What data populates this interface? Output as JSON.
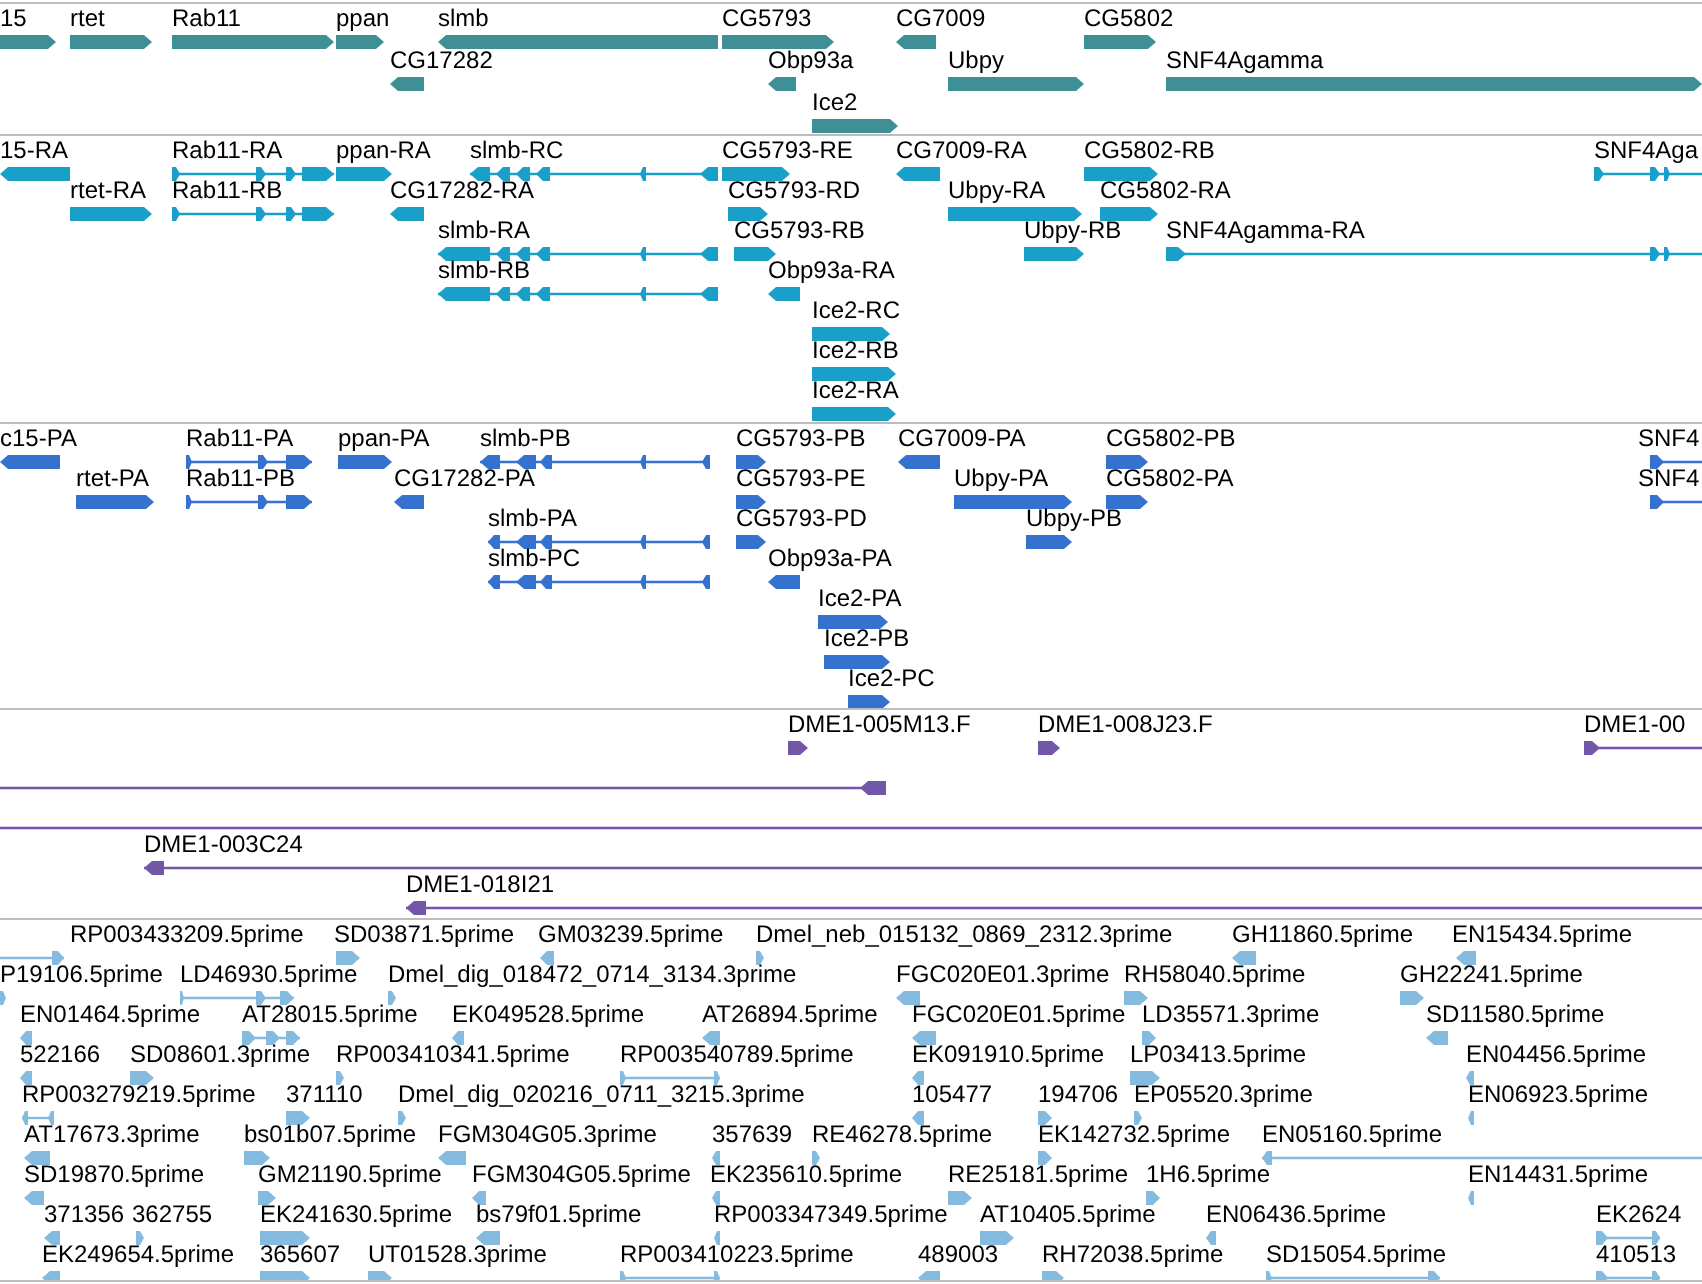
{
  "tracks": [
    {
      "kind": "gene",
      "color": "#3f8f96",
      "features": [
        {
          "label": "15",
          "reverse": false
        },
        {
          "label": "rtet",
          "reverse": false
        },
        {
          "label": "Rab11",
          "reverse": false
        },
        {
          "label": "ppan",
          "reverse": false
        },
        {
          "label": "slmb",
          "reverse": true
        },
        {
          "label": "CG5793",
          "reverse": false
        },
        {
          "label": "CG7009",
          "reverse": true
        },
        {
          "label": "CG5802",
          "reverse": false
        },
        {
          "label": "CG17282",
          "reverse": true
        },
        {
          "label": "Obp93a",
          "reverse": true
        },
        {
          "label": "Ubpy",
          "reverse": false
        },
        {
          "label": "SNF4Agamma",
          "reverse": false
        },
        {
          "label": "Ice2",
          "reverse": false
        }
      ]
    },
    {
      "kind": "transcript",
      "color": "#1aa0c8",
      "features": [
        {
          "label": "15-RA",
          "reverse": true
        },
        {
          "label": "Rab11-RA",
          "reverse": false
        },
        {
          "label": "ppan-RA",
          "reverse": false
        },
        {
          "label": "slmb-RC",
          "reverse": true
        },
        {
          "label": "CG5793-RE",
          "reverse": false
        },
        {
          "label": "CG7009-RA",
          "reverse": true
        },
        {
          "label": "CG5802-RB",
          "reverse": false
        },
        {
          "label": "SNF4Aga",
          "reverse": false
        },
        {
          "label": "rtet-RA",
          "reverse": false
        },
        {
          "label": "Rab11-RB",
          "reverse": false
        },
        {
          "label": "CG17282-RA",
          "reverse": true
        },
        {
          "label": "CG5793-RD",
          "reverse": false
        },
        {
          "label": "Ubpy-RA",
          "reverse": false
        },
        {
          "label": "CG5802-RA",
          "reverse": false
        },
        {
          "label": "slmb-RA",
          "reverse": true
        },
        {
          "label": "CG5793-RB",
          "reverse": false
        },
        {
          "label": "Ubpy-RB",
          "reverse": false
        },
        {
          "label": "SNF4Agamma-RA",
          "reverse": false
        },
        {
          "label": "slmb-RB",
          "reverse": true
        },
        {
          "label": "Obp93a-RA",
          "reverse": true
        },
        {
          "label": "Ice2-RC",
          "reverse": false
        },
        {
          "label": "Ice2-RB",
          "reverse": false
        },
        {
          "label": "Ice2-RA",
          "reverse": false
        }
      ]
    },
    {
      "kind": "protein",
      "color": "#3572d0",
      "features": [
        {
          "label": "c15-PA",
          "reverse": true
        },
        {
          "label": "Rab11-PA",
          "reverse": false
        },
        {
          "label": "ppan-PA",
          "reverse": false
        },
        {
          "label": "slmb-PB",
          "reverse": true
        },
        {
          "label": "CG5793-PB",
          "reverse": false
        },
        {
          "label": "CG7009-PA",
          "reverse": true
        },
        {
          "label": "CG5802-PB",
          "reverse": false
        },
        {
          "label": "SNF4",
          "reverse": false
        },
        {
          "label": "rtet-PA",
          "reverse": false
        },
        {
          "label": "Rab11-PB",
          "reverse": false
        },
        {
          "label": "CG17282-PA",
          "reverse": true
        },
        {
          "label": "CG5793-PE",
          "reverse": false
        },
        {
          "label": "Ubpy-PA",
          "reverse": false
        },
        {
          "label": "CG5802-PA",
          "reverse": false
        },
        {
          "label": "SNF4",
          "reverse": false
        },
        {
          "label": "slmb-PA",
          "reverse": true
        },
        {
          "label": "CG5793-PD",
          "reverse": false
        },
        {
          "label": "Ubpy-PB",
          "reverse": false
        },
        {
          "label": "slmb-PC",
          "reverse": true
        },
        {
          "label": "Obp93a-PA",
          "reverse": true
        },
        {
          "label": "Ice2-PA",
          "reverse": false
        },
        {
          "label": "Ice2-PB",
          "reverse": false
        },
        {
          "label": "Ice2-PC",
          "reverse": false
        }
      ]
    },
    {
      "kind": "clone",
      "color": "#7256a8",
      "features": [
        {
          "kind": "end",
          "label": "DME1-005M13.F",
          "reverse": false
        },
        {
          "kind": "end",
          "label": "DME1-008J23.F",
          "reverse": false
        },
        {
          "kind": "end",
          "label": "DME1-00",
          "reverse": false
        },
        {
          "kind": "end",
          "reverse": true
        },
        {
          "kind": "span"
        },
        {
          "kind": "end",
          "label": "DME1-003C24",
          "reverse": true
        },
        {
          "kind": "end",
          "label": "DME1-018I21",
          "reverse": true
        }
      ]
    },
    {
      "kind": "est",
      "color": "#86bbe0",
      "features": [
        {
          "label": "RP003433209.5prime",
          "reverse": false
        },
        {
          "label": "SD03871.5prime",
          "reverse": false
        },
        {
          "label": "GM03239.5prime",
          "reverse": true
        },
        {
          "label": "Dmel_neb_015132_0869_2312.3prime",
          "reverse": false
        },
        {
          "label": "GH11860.5prime",
          "reverse": true
        },
        {
          "label": "EN15434.5prime",
          "reverse": true
        },
        {
          "label": "P19106.5prime",
          "reverse": false
        },
        {
          "label": "LD46930.5prime",
          "reverse": false
        },
        {
          "label": "Dmel_dig_018472_0714_3134.3prime",
          "reverse": false
        },
        {
          "label": "FGC020E01.3prime",
          "reverse": true
        },
        {
          "label": "RH58040.5prime",
          "reverse": false
        },
        {
          "label": "GH22241.5prime",
          "reverse": false
        },
        {
          "label": "EN01464.5prime",
          "reverse": true
        },
        {
          "label": "AT28015.5prime",
          "reverse": false
        },
        {
          "label": "EK049528.5prime",
          "reverse": true
        },
        {
          "label": "AT26894.5prime",
          "reverse": true
        },
        {
          "label": "FGC020E01.5prime",
          "reverse": true
        },
        {
          "label": "LD35571.3prime",
          "reverse": false
        },
        {
          "label": "SD11580.5prime",
          "reverse": true
        },
        {
          "label": "522166",
          "reverse": true
        },
        {
          "label": "SD08601.3prime",
          "reverse": false
        },
        {
          "label": "RP003410341.5prime",
          "reverse": false
        },
        {
          "label": "RP003540789.5prime",
          "reverse": false
        },
        {
          "label": "EK091910.5prime",
          "reverse": true
        },
        {
          "label": "LP03413.5prime",
          "reverse": false
        },
        {
          "label": "EN04456.5prime",
          "reverse": true
        },
        {
          "label": "RP003279219.5prime",
          "reverse": true
        },
        {
          "label": "371110",
          "reverse": false
        },
        {
          "label": "Dmel_dig_020216_0711_3215.3prime",
          "reverse": false
        },
        {
          "label": "105477",
          "reverse": true
        },
        {
          "label": "194706",
          "reverse": false
        },
        {
          "label": "EP05520.3prime",
          "reverse": false
        },
        {
          "label": "EN06923.5prime",
          "reverse": true
        },
        {
          "label": "AT17673.3prime",
          "reverse": true
        },
        {
          "label": "bs01b07.5prime",
          "reverse": false
        },
        {
          "label": "FGM304G05.3prime",
          "reverse": true
        },
        {
          "label": "357639",
          "reverse": true
        },
        {
          "label": "RE46278.5prime",
          "reverse": false
        },
        {
          "label": "EK142732.5prime",
          "reverse": false
        },
        {
          "label": "EN05160.5prime",
          "reverse": true
        },
        {
          "label": "SD19870.5prime",
          "reverse": true
        },
        {
          "label": "GM21190.5prime",
          "reverse": false
        },
        {
          "label": "FGM304G05.5prime",
          "reverse": true
        },
        {
          "label": "EK235610.5prime",
          "reverse": true
        },
        {
          "label": "RE25181.5prime",
          "reverse": false
        },
        {
          "label": "1H6.5prime",
          "reverse": false
        },
        {
          "label": "EN14431.5prime",
          "reverse": true
        },
        {
          "label": "371356",
          "reverse": true
        },
        {
          "label": "362755",
          "reverse": false
        },
        {
          "label": "EK241630.5prime",
          "reverse": false
        },
        {
          "label": "bs79f01.5prime",
          "reverse": true
        },
        {
          "label": "RP003347349.5prime",
          "reverse": true
        },
        {
          "label": "AT10405.5prime",
          "reverse": false
        },
        {
          "label": "EN06436.5prime",
          "reverse": true
        },
        {
          "label": "EK2624",
          "reverse": false
        },
        {
          "label": "EK249654.5prime",
          "reverse": true
        },
        {
          "label": "365607",
          "reverse": false
        },
        {
          "label": "UT01528.3prime",
          "reverse": false
        },
        {
          "label": "RP003410223.5prime",
          "reverse": false
        },
        {
          "label": "489003",
          "reverse": true
        },
        {
          "label": "RH72038.5prime",
          "reverse": false
        },
        {
          "label": "SD15054.5prime",
          "reverse": false
        },
        {
          "label": "410513",
          "reverse": false
        }
      ]
    }
  ]
}
